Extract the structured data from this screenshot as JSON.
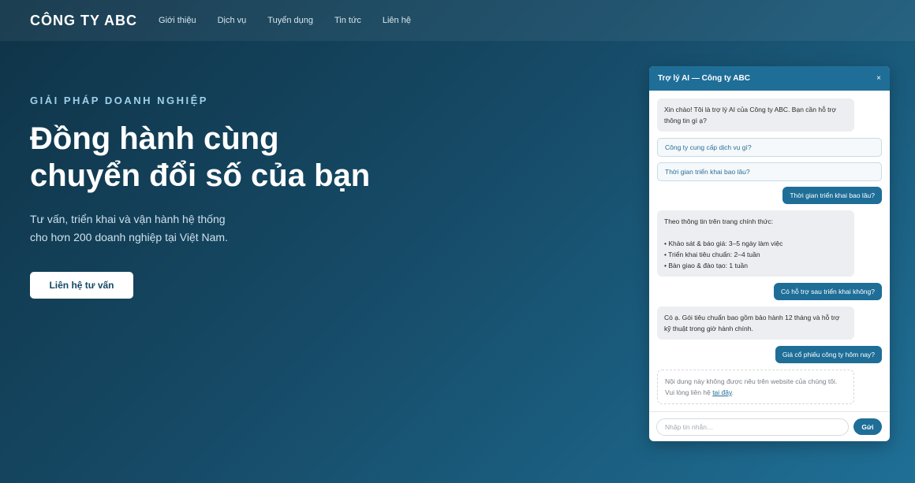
{
  "header": {
    "brand": "CÔNG TY ABC",
    "nav": [
      "Giới thiệu",
      "Dịch vụ",
      "Tuyển dụng",
      "Tin tức",
      "Liên hệ"
    ]
  },
  "hero": {
    "eyebrow": "GIẢI PHÁP DOANH NGHIỆP",
    "headline_line1": "Đồng hành cùng",
    "headline_line2": "chuyển đổi số của bạn",
    "sub_line1": "Tư vấn, triển khai và vận hành hệ thống",
    "sub_line2": "cho hơn 200 doanh nghiệp tại Việt Nam.",
    "cta": "Liên hệ tư vấn"
  },
  "chat": {
    "title": "Trợ lý AI — Công ty ABC",
    "close": "×",
    "greeting": "Xin chào! Tôi là trợ lý AI của Công ty ABC. Bạn cần hỗ trợ thông tin gì ạ?",
    "suggestions": [
      "Công ty cung cấp dịch vụ gì?",
      "Thời gian triển khai bao lâu?"
    ],
    "user_1": "Thời gian triển khai bao lâu?",
    "bot_1_intro": "Theo thông tin trên trang chính thức:",
    "bot_1_items": [
      "• Khảo sát & báo giá: 3–5 ngày làm việc",
      "• Triển khai tiêu chuẩn: 2–4 tuần",
      "• Bàn giao & đào tạo: 1 tuần"
    ],
    "user_2": "Có hỗ trợ sau triển khai không?",
    "bot_2": "Có ạ. Gói tiêu chuẩn bao gồm bảo hành 12 tháng và hỗ trợ kỹ thuật trong giờ hành chính.",
    "user_3": "Giá cổ phiếu công ty hôm nay?",
    "bot_3_line1": "Nội dung này không được nêu trên website của chúng tôi.",
    "bot_3_line2_prefix": "Vui lòng liên hệ",
    "bot_3_link": "tại đây",
    "bot_3_suffix": ".",
    "input_placeholder": "Nhập tin nhắn…",
    "send": "Gửi"
  },
  "colors": {
    "accent": "#1e6e98",
    "background_dark": "#0f3347",
    "background_light": "#1f6f96"
  }
}
